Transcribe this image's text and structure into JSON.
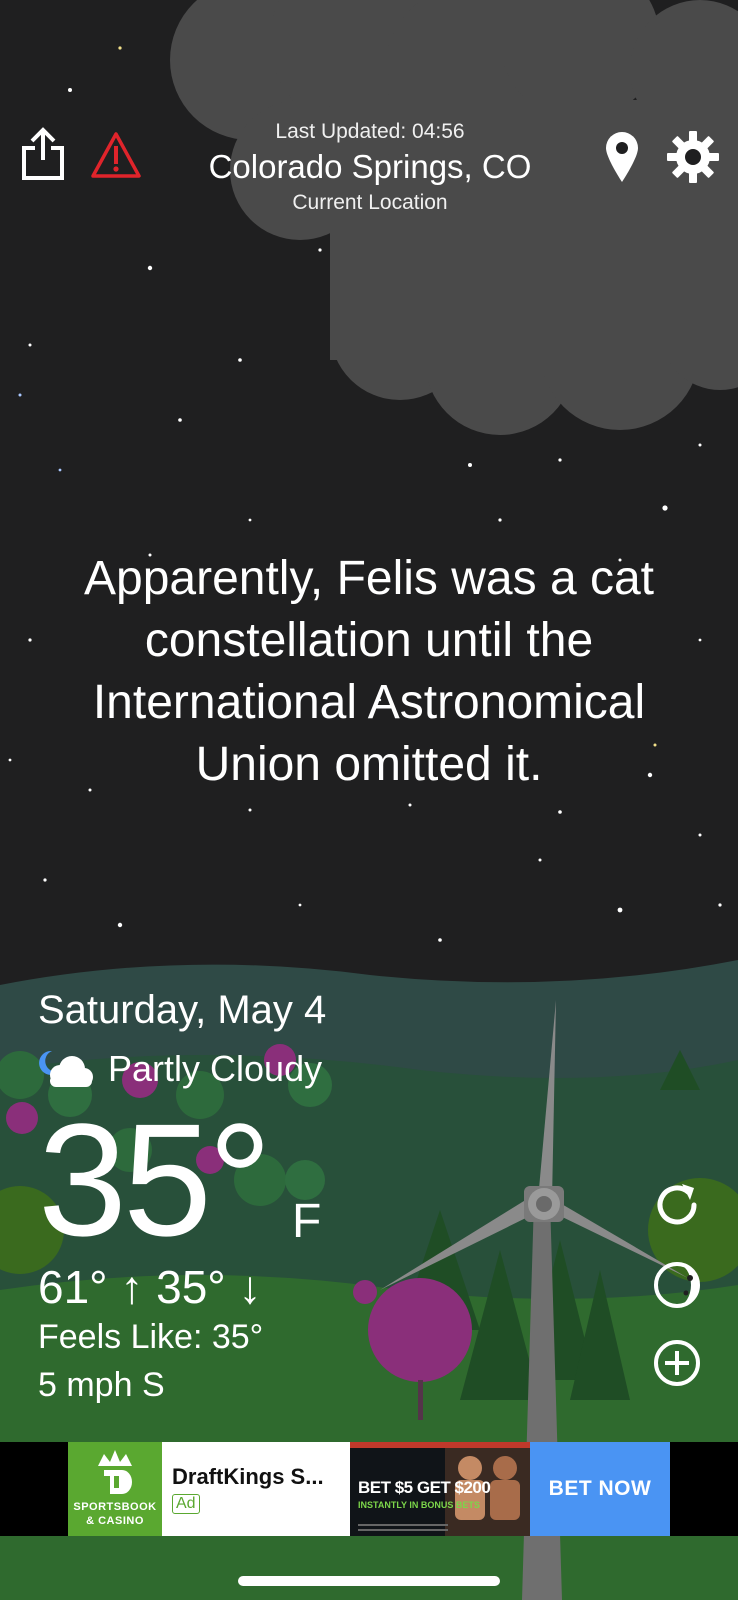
{
  "header": {
    "last_updated": "Last Updated: 04:56",
    "city": "Colorado Springs, CO",
    "location_label": "Current Location"
  },
  "icons": {
    "share": "share-icon",
    "alert": "warning-triangle-icon",
    "location": "location-pin-icon",
    "settings": "gear-icon",
    "refresh": "refresh-icon",
    "moon": "moon-phase-icon",
    "add": "plus-circle-icon",
    "condition": "partly-cloudy-night-icon"
  },
  "fact": {
    "text": "Apparently, Felis was a cat constellation until the International Astronomical Union omitted it."
  },
  "weather": {
    "date": "Saturday, May 4",
    "condition": "Partly Cloudy",
    "temperature": "35°",
    "unit": "F",
    "hi_lo": "61° ↑ 35° ↓",
    "feels_like": "Feels Like: 35°",
    "wind": "5 mph S"
  },
  "ad": {
    "logo_text": "SPORTSBOOK & CASINO",
    "title": "DraftKings S...",
    "badge": "Ad",
    "promo": "BET $5 GET $200",
    "promo_sub": "INSTANTLY IN BONUS BETS",
    "cta": "BET NOW"
  },
  "colors": {
    "sky": "#1f1f20",
    "cloud": "#4a4a4a",
    "hill": "#2f4a46",
    "grass": "#2f6a2e",
    "alert": "#e0242b",
    "ad_green": "#5aa830",
    "ad_blue": "#4a94f3"
  }
}
